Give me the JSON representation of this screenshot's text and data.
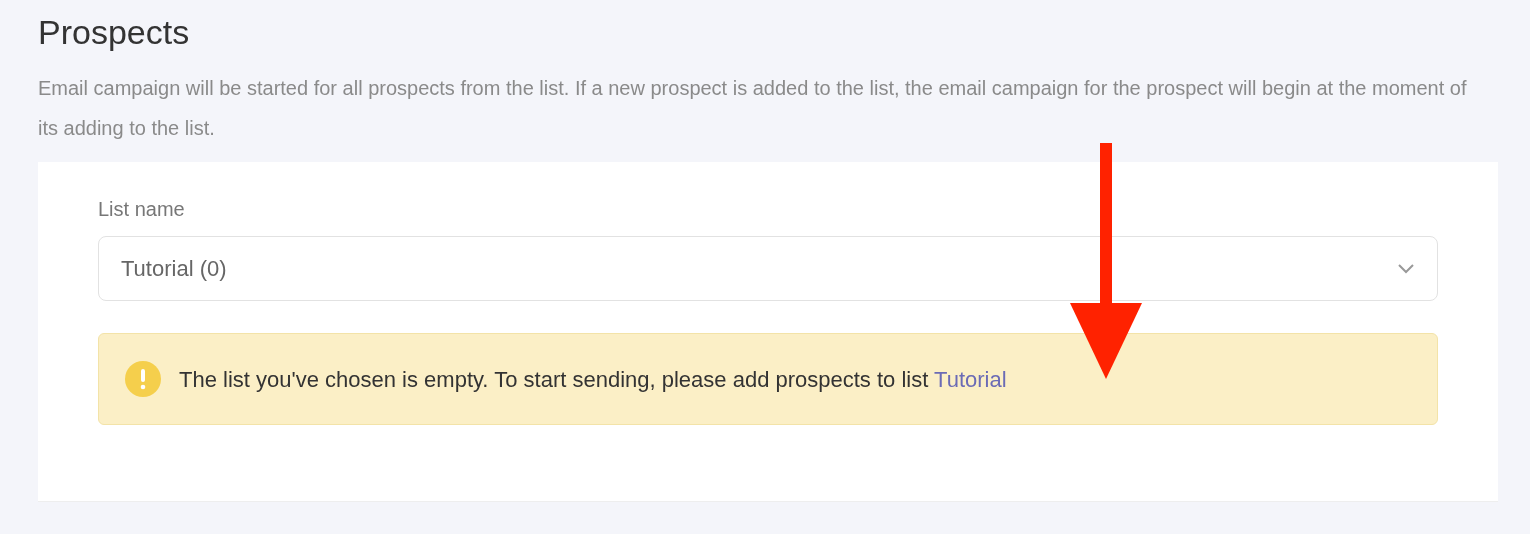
{
  "page": {
    "title": "Prospects",
    "description": "Email campaign will be started for all prospects from the list. If a new prospect is added to the list, the email campaign for the prospect will begin at the moment of its adding to the list."
  },
  "list_select": {
    "label": "List name",
    "value": "Tutorial (0)"
  },
  "warning": {
    "text": "The list you've chosen is empty. To start sending, please add prospects to list",
    "link": "Tutorial"
  }
}
